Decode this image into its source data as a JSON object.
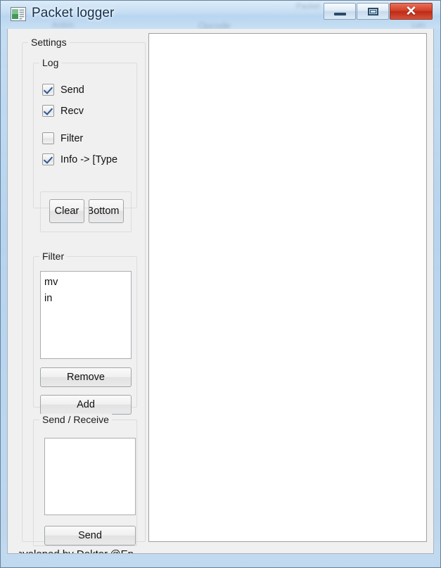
{
  "window": {
    "title": "Packet logger",
    "icon": "application-form-icon",
    "controls": {
      "minimize": "minimize-button",
      "maximize": "maximize-button",
      "close_glyph": "✕"
    }
  },
  "settings": {
    "label": "Settings",
    "log": {
      "label": "Log",
      "checkboxes": [
        {
          "label": "Send",
          "checked": true
        },
        {
          "label": "Recv",
          "checked": true
        },
        {
          "label": "Filter",
          "checked": false
        },
        {
          "label": "Info -> [Type",
          "checked": true
        }
      ],
      "buttons": [
        {
          "label": "Clear"
        },
        {
          "label": "Bottom"
        }
      ]
    },
    "filter": {
      "label": "Filter",
      "items": [
        "mv",
        "in"
      ],
      "buttons": [
        {
          "label": "Remove"
        },
        {
          "label": "Add"
        }
      ]
    },
    "send_receive": {
      "label": "Send / Receive",
      "input_value": "",
      "button": {
        "label": "Send"
      }
    },
    "credit": "Developed by Doktor.@Ep"
  },
  "log_panel": {
    "name": "log-output-panel",
    "content": ""
  },
  "colors": {
    "accent_check": "#2b5797",
    "close_button": "#d5412a",
    "client_bg": "#f0f0f0",
    "field_bg": "#ffffff"
  }
}
